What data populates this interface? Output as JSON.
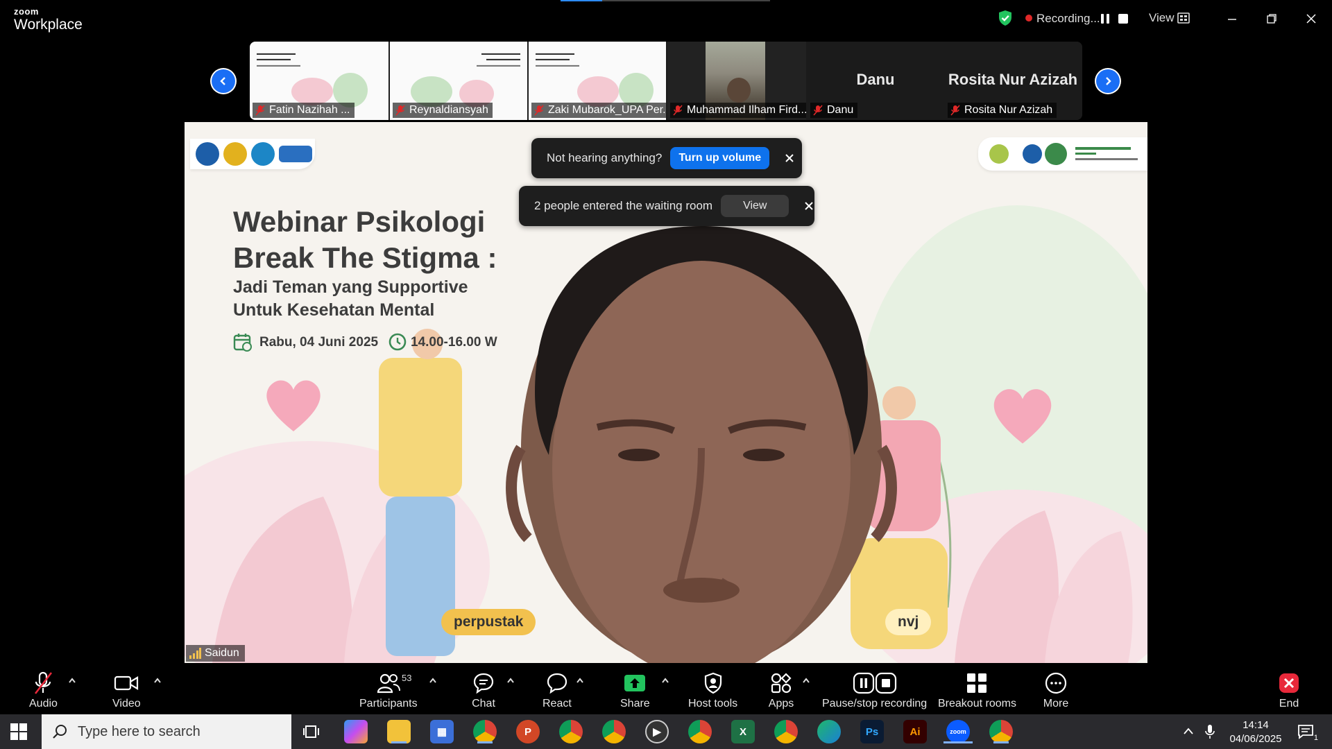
{
  "app": {
    "brand_small": "zoom",
    "brand_large": "Workplace"
  },
  "titlebar": {
    "recording_label": "Recording...",
    "view_label": "View"
  },
  "filmstrip": {
    "tiles": [
      {
        "name": "Fatin Nazihah ...",
        "kind": "slide"
      },
      {
        "name": "Reynaldiansyah",
        "kind": "slide"
      },
      {
        "name": "Zaki Mubarok_UPA Per...",
        "kind": "slide"
      },
      {
        "name": "Muhammad Ilham Fird...",
        "kind": "camera"
      },
      {
        "name": "Danu",
        "display_name": "Danu",
        "kind": "avatar"
      },
      {
        "name": "Rosita Nur Azizah",
        "display_name": "Rosita Nur Azizah",
        "kind": "avatar"
      }
    ]
  },
  "main_video": {
    "slide_title_line1": "Webinar Psikologi",
    "slide_title_line2": "Break The Stigma :",
    "slide_sub_line1": "Jadi Teman yang Supportive",
    "slide_sub_line2": "Untuk Kesehatan Mental",
    "slide_date": "Rabu, 04 Juni 2025",
    "slide_time": "14.00-16.00 W",
    "pill_left": "perpustak",
    "pill_right": "nvj",
    "speaker_name": "Saidun"
  },
  "notifications": {
    "audio": {
      "text": "Not hearing anything?",
      "button": "Turn up volume"
    },
    "waiting_room": {
      "text": "2 people entered the waiting room",
      "button": "View"
    }
  },
  "toolbar": {
    "audio": "Audio",
    "video": "Video",
    "participants": "Participants",
    "participants_count": "53",
    "chat": "Chat",
    "react": "React",
    "share": "Share",
    "host_tools": "Host tools",
    "apps": "Apps",
    "pause_stop": "Pause/stop recording",
    "breakout": "Breakout rooms",
    "more": "More",
    "end": "End"
  },
  "taskbar": {
    "search_placeholder": "Type here to search",
    "time": "14:14",
    "date": "04/06/2025",
    "notification_count": "1"
  },
  "colors": {
    "accent_blue": "#0e72ed",
    "recording_red": "#e02828",
    "share_green": "#22c35e",
    "end_red": "#e8283a"
  }
}
